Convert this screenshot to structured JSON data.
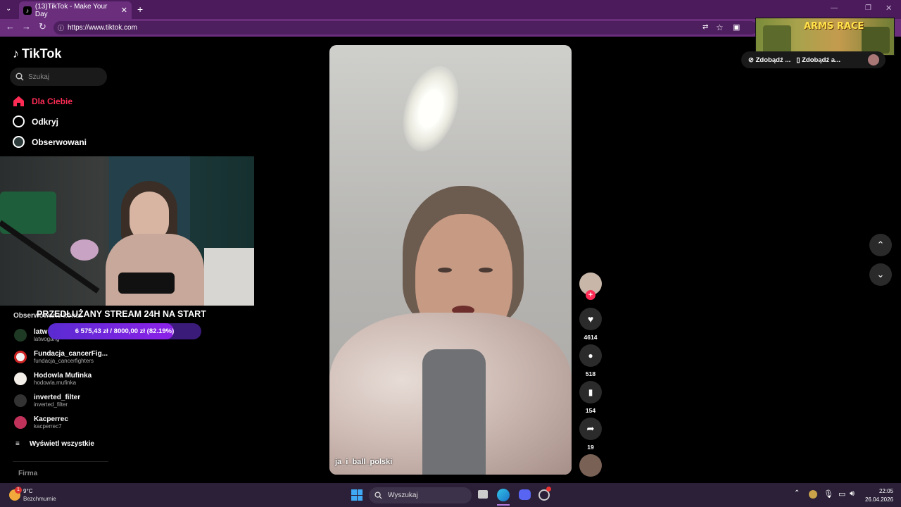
{
  "browser": {
    "tab_title": "(13)TikTok - Make Your Day",
    "url": "https://www.tiktok.com"
  },
  "sidebar": {
    "logo": "TikTok",
    "search_placeholder": "Szukaj",
    "nav": [
      {
        "label": "Dla Ciebie",
        "active": true
      },
      {
        "label": "Odkryj"
      },
      {
        "label": "Obserwowani"
      }
    ],
    "following_header": "Obserwowane konta",
    "following": [
      {
        "name": "latwogang",
        "handle": "latwogang"
      },
      {
        "name": "Fundacja_cancerFig...",
        "handle": "fundacja_cancerfighters"
      },
      {
        "name": "Hodowla Mufinka",
        "handle": "hodowla.mufinka"
      },
      {
        "name": "inverted_filter",
        "handle": "inverted_filter"
      },
      {
        "name": "Kacperrec",
        "handle": "kacperrec7"
      }
    ],
    "show_all": "Wyświetl wszystkie",
    "footer": "Firma"
  },
  "overlay": {
    "stream_title": "PRZEDŁUŻANY STREAM 24H NA START",
    "progress_text": "6 575,43 zł / 8000,00 zł (82.19%)",
    "progress_fraction": 0.8219
  },
  "video": {
    "author": "ja_i_ball_polski",
    "likes": "4614",
    "comments": "518",
    "saves": "154",
    "shares": "19"
  },
  "topright": {
    "game_title": "ARMS RACE",
    "get_coins": "Zdobądź ...",
    "get_app": "Zdobądź a..."
  },
  "taskbar": {
    "weather_temp": "9°C",
    "weather_desc": "Bezchmurnie",
    "search_label": "Wyszukaj",
    "time": "22:05",
    "date": "26.04.2026"
  },
  "colors": {
    "accent": "#fe2c55",
    "browser": "#4b1b5c"
  }
}
